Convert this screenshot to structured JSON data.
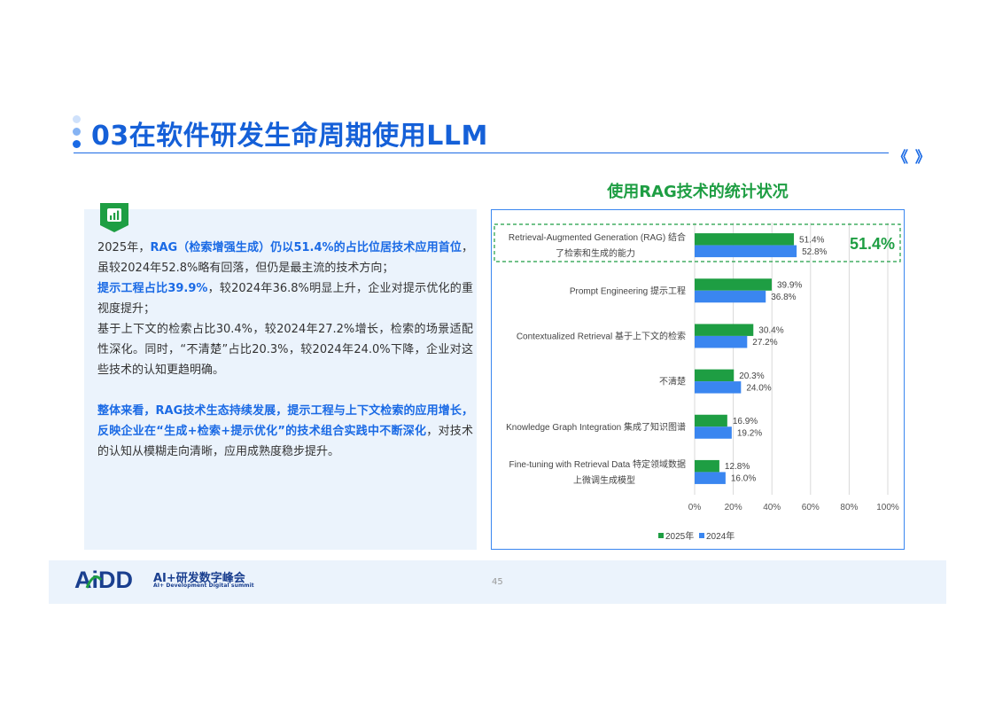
{
  "header": {
    "title": "03在软件研发生命周期使用LLM",
    "nav_glyph": "《 》"
  },
  "chart_title": "使用RAG技术的统计状况",
  "text": {
    "p1": {
      "a": "2025年，",
      "b": "RAG（检索增强生成）仍以51.4%的占比位居技术应用首位",
      "c": "，虽较2024年52.8%略有回落，但仍是最主流的技术方向；"
    },
    "p2": {
      "a": "提示工程占比39.9%",
      "b": "，较2024年36.8%明显上升，企业对提示优化的重视度提升；"
    },
    "p3": "基于上下文的检索占比30.4%，较2024年27.2%增长，检索的场景适配性深化。同时，“不清楚”占比20.3%，较2024年24.0%下降，企业对这些技术的认知更趋明确。",
    "p4": {
      "a": "整体来看，RAG技术生态持续发展，提示工程与上下文检索的应用增长，反映企业在“生成+检索+提示优化”的技术组合实践中不断深化",
      "b": "，对技术的认知从模糊走向清晰，应用成熟度稳步提升。"
    }
  },
  "chart_data": {
    "type": "bar",
    "orientation": "horizontal",
    "categories": [
      [
        "Retrieval-Augmented Generation (RAG) 结合",
        "了检索和生成的能力"
      ],
      [
        "Prompt Engineering 提示工程"
      ],
      [
        "Contextualized Retrieval 基于上下文的检索"
      ],
      [
        "不清楚"
      ],
      [
        "Knowledge Graph Integration 集成了知识图谱"
      ],
      [
        "Fine-tuning with Retrieval Data 特定领域数据",
        "上微调生成模型"
      ]
    ],
    "series": [
      {
        "name": "2025年",
        "values": [
          51.4,
          39.9,
          30.4,
          20.3,
          16.9,
          12.8
        ],
        "color": "#1e9e43"
      },
      {
        "name": "2024年",
        "values": [
          52.8,
          36.8,
          27.2,
          24.0,
          19.2,
          16.0
        ],
        "color": "#3a86f0"
      }
    ],
    "xlim": [
      0,
      100
    ],
    "xticks": [
      "0%",
      "20%",
      "40%",
      "60%",
      "80%",
      "100%"
    ],
    "xtick_values": [
      0,
      20,
      40,
      60,
      80,
      100
    ],
    "grid": true,
    "legend": "bottom",
    "highlight_label": "51.4%",
    "highlight_color": "#1e9e43"
  },
  "footer": {
    "logo_text": "AiDD",
    "logo_cn": "AI+研发数字峰会",
    "logo_en": "AI+ Development Digital summit",
    "page_number": "45"
  }
}
